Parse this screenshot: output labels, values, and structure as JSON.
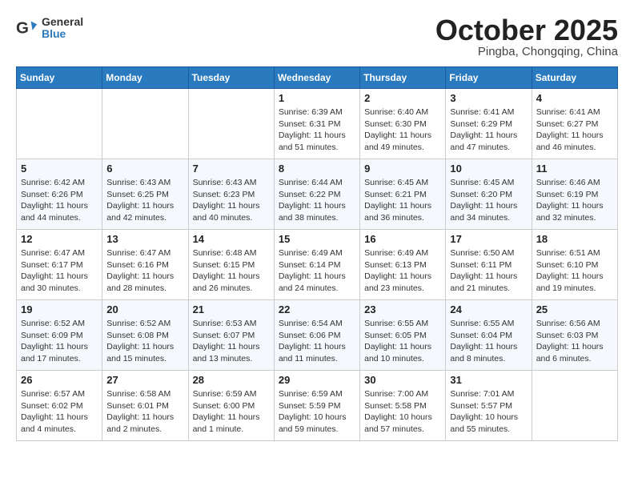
{
  "header": {
    "logo": {
      "line1": "General",
      "line2": "Blue"
    },
    "month": "October 2025",
    "location": "Pingba, Chongqing, China"
  },
  "weekdays": [
    "Sunday",
    "Monday",
    "Tuesday",
    "Wednesday",
    "Thursday",
    "Friday",
    "Saturday"
  ],
  "weeks": [
    [
      {
        "day": "",
        "info": ""
      },
      {
        "day": "",
        "info": ""
      },
      {
        "day": "",
        "info": ""
      },
      {
        "day": "1",
        "info": "Sunrise: 6:39 AM\nSunset: 6:31 PM\nDaylight: 11 hours\nand 51 minutes."
      },
      {
        "day": "2",
        "info": "Sunrise: 6:40 AM\nSunset: 6:30 PM\nDaylight: 11 hours\nand 49 minutes."
      },
      {
        "day": "3",
        "info": "Sunrise: 6:41 AM\nSunset: 6:29 PM\nDaylight: 11 hours\nand 47 minutes."
      },
      {
        "day": "4",
        "info": "Sunrise: 6:41 AM\nSunset: 6:27 PM\nDaylight: 11 hours\nand 46 minutes."
      }
    ],
    [
      {
        "day": "5",
        "info": "Sunrise: 6:42 AM\nSunset: 6:26 PM\nDaylight: 11 hours\nand 44 minutes."
      },
      {
        "day": "6",
        "info": "Sunrise: 6:43 AM\nSunset: 6:25 PM\nDaylight: 11 hours\nand 42 minutes."
      },
      {
        "day": "7",
        "info": "Sunrise: 6:43 AM\nSunset: 6:23 PM\nDaylight: 11 hours\nand 40 minutes."
      },
      {
        "day": "8",
        "info": "Sunrise: 6:44 AM\nSunset: 6:22 PM\nDaylight: 11 hours\nand 38 minutes."
      },
      {
        "day": "9",
        "info": "Sunrise: 6:45 AM\nSunset: 6:21 PM\nDaylight: 11 hours\nand 36 minutes."
      },
      {
        "day": "10",
        "info": "Sunrise: 6:45 AM\nSunset: 6:20 PM\nDaylight: 11 hours\nand 34 minutes."
      },
      {
        "day": "11",
        "info": "Sunrise: 6:46 AM\nSunset: 6:19 PM\nDaylight: 11 hours\nand 32 minutes."
      }
    ],
    [
      {
        "day": "12",
        "info": "Sunrise: 6:47 AM\nSunset: 6:17 PM\nDaylight: 11 hours\nand 30 minutes."
      },
      {
        "day": "13",
        "info": "Sunrise: 6:47 AM\nSunset: 6:16 PM\nDaylight: 11 hours\nand 28 minutes."
      },
      {
        "day": "14",
        "info": "Sunrise: 6:48 AM\nSunset: 6:15 PM\nDaylight: 11 hours\nand 26 minutes."
      },
      {
        "day": "15",
        "info": "Sunrise: 6:49 AM\nSunset: 6:14 PM\nDaylight: 11 hours\nand 24 minutes."
      },
      {
        "day": "16",
        "info": "Sunrise: 6:49 AM\nSunset: 6:13 PM\nDaylight: 11 hours\nand 23 minutes."
      },
      {
        "day": "17",
        "info": "Sunrise: 6:50 AM\nSunset: 6:11 PM\nDaylight: 11 hours\nand 21 minutes."
      },
      {
        "day": "18",
        "info": "Sunrise: 6:51 AM\nSunset: 6:10 PM\nDaylight: 11 hours\nand 19 minutes."
      }
    ],
    [
      {
        "day": "19",
        "info": "Sunrise: 6:52 AM\nSunset: 6:09 PM\nDaylight: 11 hours\nand 17 minutes."
      },
      {
        "day": "20",
        "info": "Sunrise: 6:52 AM\nSunset: 6:08 PM\nDaylight: 11 hours\nand 15 minutes."
      },
      {
        "day": "21",
        "info": "Sunrise: 6:53 AM\nSunset: 6:07 PM\nDaylight: 11 hours\nand 13 minutes."
      },
      {
        "day": "22",
        "info": "Sunrise: 6:54 AM\nSunset: 6:06 PM\nDaylight: 11 hours\nand 11 minutes."
      },
      {
        "day": "23",
        "info": "Sunrise: 6:55 AM\nSunset: 6:05 PM\nDaylight: 11 hours\nand 10 minutes."
      },
      {
        "day": "24",
        "info": "Sunrise: 6:55 AM\nSunset: 6:04 PM\nDaylight: 11 hours\nand 8 minutes."
      },
      {
        "day": "25",
        "info": "Sunrise: 6:56 AM\nSunset: 6:03 PM\nDaylight: 11 hours\nand 6 minutes."
      }
    ],
    [
      {
        "day": "26",
        "info": "Sunrise: 6:57 AM\nSunset: 6:02 PM\nDaylight: 11 hours\nand 4 minutes."
      },
      {
        "day": "27",
        "info": "Sunrise: 6:58 AM\nSunset: 6:01 PM\nDaylight: 11 hours\nand 2 minutes."
      },
      {
        "day": "28",
        "info": "Sunrise: 6:59 AM\nSunset: 6:00 PM\nDaylight: 11 hours\nand 1 minute."
      },
      {
        "day": "29",
        "info": "Sunrise: 6:59 AM\nSunset: 5:59 PM\nDaylight: 10 hours\nand 59 minutes."
      },
      {
        "day": "30",
        "info": "Sunrise: 7:00 AM\nSunset: 5:58 PM\nDaylight: 10 hours\nand 57 minutes."
      },
      {
        "day": "31",
        "info": "Sunrise: 7:01 AM\nSunset: 5:57 PM\nDaylight: 10 hours\nand 55 minutes."
      },
      {
        "day": "",
        "info": ""
      }
    ]
  ]
}
